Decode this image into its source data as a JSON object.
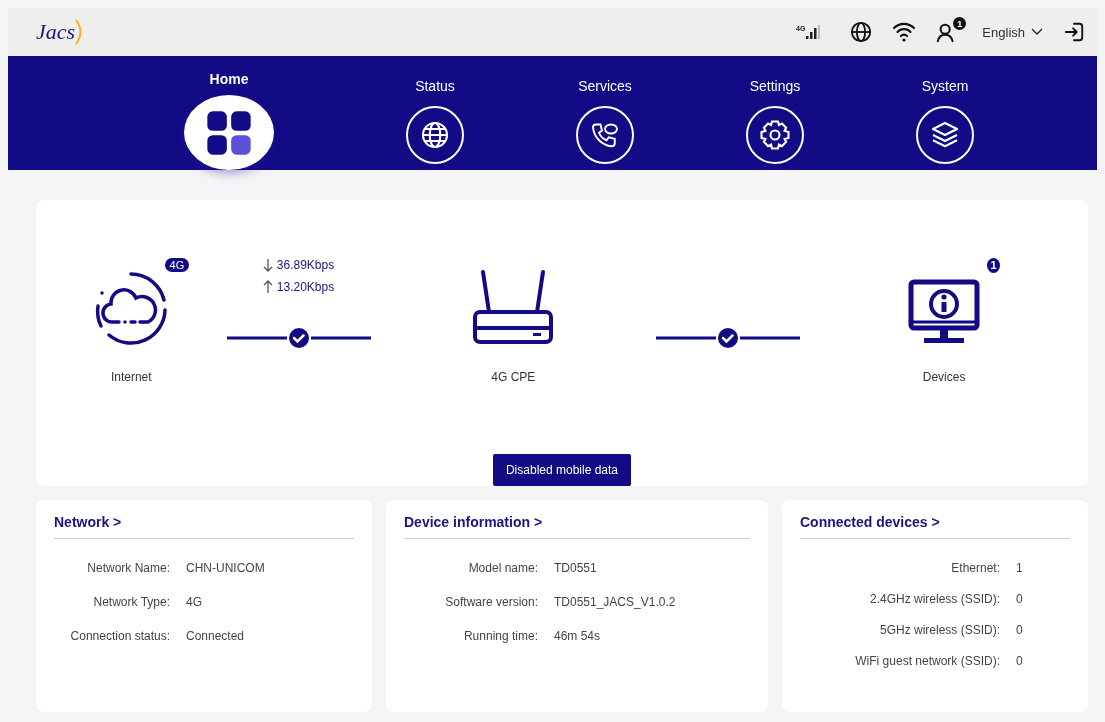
{
  "header": {
    "logo": "Jacs",
    "signal_label": "4G",
    "notification_count": "1",
    "language": "English"
  },
  "tabs": [
    {
      "label": "Home",
      "selected": true
    },
    {
      "label": "Status",
      "selected": false
    },
    {
      "label": "Services",
      "selected": false
    },
    {
      "label": "Settings",
      "selected": false
    },
    {
      "label": "System",
      "selected": false
    }
  ],
  "topology": {
    "internet": {
      "label": "Internet",
      "badge": "4G"
    },
    "download": "36.89Kbps",
    "upload": "13.20Kbps",
    "router": {
      "label": "4G CPE"
    },
    "devices": {
      "label": "Devices",
      "badge": "1"
    },
    "button": "Disabled mobile data"
  },
  "cards": [
    {
      "title": "Network >",
      "rows": [
        {
          "label": "Network Name:",
          "value": "CHN-UNICOM"
        },
        {
          "label": "Network Type:",
          "value": "4G"
        },
        {
          "label": "Connection status:",
          "value": "Connected"
        }
      ]
    },
    {
      "title": "Device information >",
      "rows": [
        {
          "label": "Model name:",
          "value": "TD0551"
        },
        {
          "label": "Software version:",
          "value": "TD0551_JACS_V1.0.2"
        },
        {
          "label": "Running time:",
          "value": "46m 54s"
        }
      ]
    },
    {
      "title": "Connected devices >",
      "rows": [
        {
          "label": "Ethernet:",
          "value": "1"
        },
        {
          "label": "2.4GHz wireless (SSID):",
          "value": "0"
        },
        {
          "label": "5GHz wireless (SSID):",
          "value": "0"
        },
        {
          "label": "WiFi guest network (SSID):",
          "value": "0"
        }
      ]
    }
  ]
}
